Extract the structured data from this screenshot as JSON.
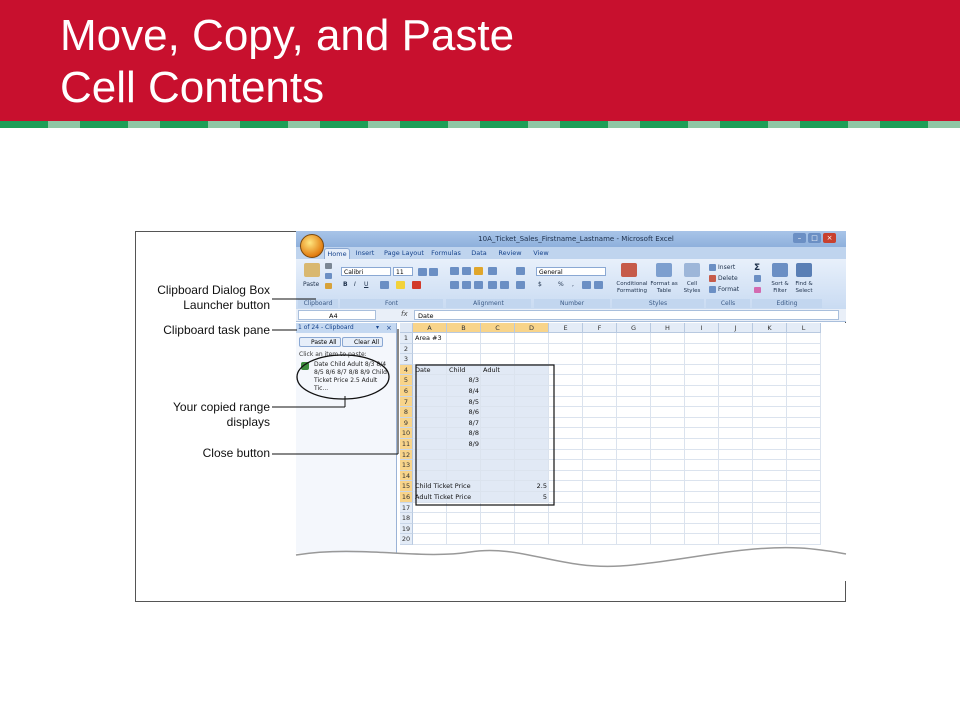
{
  "slide": {
    "title": "Move, Copy, and Paste\nCell Contents"
  },
  "callouts": {
    "launcher_line1": "Clipboard Dialog Box",
    "launcher_line2": "Launcher button",
    "task_pane": "Clipboard task pane",
    "copied_range": "Your copied range displays",
    "close_button": "Close button"
  },
  "excel": {
    "window_title": "10A_Ticket_Sales_Firstname_Lastname - Microsoft Excel",
    "tabs": [
      "Home",
      "Insert",
      "Page Layout",
      "Formulas",
      "Data",
      "Review",
      "View"
    ],
    "ribbon": {
      "paste": "Paste",
      "font_name": "Calibri",
      "font_size": "11",
      "number_format": "General",
      "conditional_formatting": "Conditional Formatting",
      "format_as_table": "Format as Table",
      "cell_styles": "Cell Styles",
      "insert": "Insert",
      "delete": "Delete",
      "format": "Format",
      "sort_filter": "Sort & Filter",
      "find_select": "Find & Select",
      "groups": [
        "Clipboard",
        "Font",
        "Alignment",
        "Number",
        "Styles",
        "Cells",
        "Editing"
      ]
    },
    "name_box": "A4",
    "fx": "fx",
    "formula": "Date",
    "clipboard_pane": {
      "header": "1 of 24 - Clipboard",
      "paste_all": "Paste All",
      "clear_all": "Clear All",
      "hint": "Click an item to paste:",
      "item": "Date Child Adult 8/3 8/4 8/5 8/6 8/7 8/8 8/9 Child Ticket Price 2.5 Adult Tic..."
    },
    "columns": [
      "A",
      "B",
      "C",
      "D",
      "E",
      "F",
      "G",
      "H",
      "I",
      "J",
      "K",
      "L"
    ],
    "rows": [
      "1",
      "2",
      "3",
      "4",
      "5",
      "6",
      "7",
      "8",
      "9",
      "10",
      "11",
      "12",
      "13",
      "14",
      "15",
      "16",
      "17",
      "18",
      "19",
      "20"
    ],
    "cells": {
      "a1": "Area #3",
      "a4": "Date",
      "b4": "Child",
      "c4": "Adult",
      "b5": "8/3",
      "b6": "8/4",
      "b7": "8/5",
      "b8": "8/6",
      "b9": "8/7",
      "b10": "8/8",
      "b11": "8/9",
      "a15": "Child Ticket Price",
      "d15": "2.5",
      "a16": "Adult Ticket Price",
      "d16": "5"
    }
  },
  "colors": {
    "title_bar": "#c8102e",
    "stripe_dark": "#1d9e57",
    "stripe_light": "#8fc6a4"
  }
}
